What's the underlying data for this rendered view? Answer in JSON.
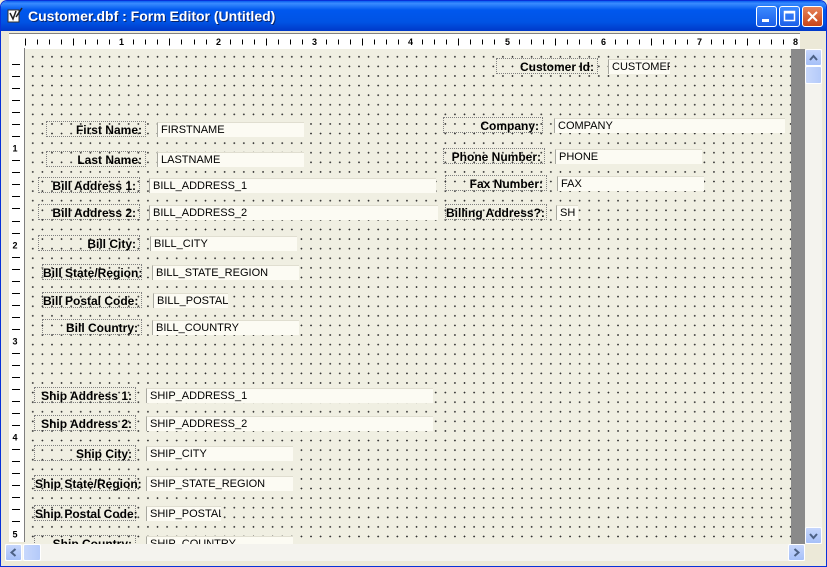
{
  "window": {
    "title": "Customer.dbf : Form Editor (Untitled)"
  },
  "ruler": {
    "h_marks": [
      "1",
      "2",
      "3",
      "4",
      "5",
      "6",
      "7",
      "8"
    ],
    "v_marks": [
      "1",
      "2",
      "3",
      "4",
      "5"
    ]
  },
  "form": {
    "customer_id": {
      "label": "Customer Id:",
      "field": "CUSTOMER"
    },
    "first_name": {
      "label": "First Name:",
      "field": "FIRSTNAME"
    },
    "last_name": {
      "label": "Last Name:",
      "field": "LASTNAME"
    },
    "bill_address_1": {
      "label": "Bill Address 1:",
      "field": "BILL_ADDRESS_1"
    },
    "bill_address_2": {
      "label": "Bill Address 2:",
      "field": "BILL_ADDRESS_2"
    },
    "bill_city": {
      "label": "Bill City:",
      "field": "BILL_CITY"
    },
    "bill_state": {
      "label": "Bill State/Region:",
      "field": "BILL_STATE_REGION"
    },
    "bill_postal": {
      "label": "Bill Postal Code:",
      "field": "BILL_POSTAL_"
    },
    "bill_country": {
      "label": "Bill Country:",
      "field": "BILL_COUNTRY"
    },
    "company": {
      "label": "Company:",
      "field": "COMPANY"
    },
    "phone": {
      "label": "Phone Number:",
      "field": "PHONE"
    },
    "fax": {
      "label": "Fax Number:",
      "field": "FAX"
    },
    "billing_address": {
      "label": "Billing Address?:",
      "field": "SH"
    },
    "ship_address_1": {
      "label": "Ship Address 1:",
      "field": "SHIP_ADDRESS_1"
    },
    "ship_address_2": {
      "label": "Ship Address 2:",
      "field": "SHIP_ADDRESS_2"
    },
    "ship_city": {
      "label": "Ship City:",
      "field": "SHIP_CITY"
    },
    "ship_state": {
      "label": "Ship State/Region:",
      "field": "SHIP_STATE_REGION"
    },
    "ship_postal": {
      "label": "Ship Postal Code:",
      "field": "SHIP_POSTAL_"
    },
    "ship_country": {
      "label": "Ship Country:",
      "field": "SHIP_COUNTRY"
    }
  },
  "icons": {
    "app": "form-editor-icon",
    "minimize": "minimize-icon",
    "maximize": "maximize-icon",
    "close": "close-icon"
  },
  "colors": {
    "titlebar": "#0053E4",
    "canvas": "#F0EFE2",
    "field_bg": "#FCFBF3"
  }
}
